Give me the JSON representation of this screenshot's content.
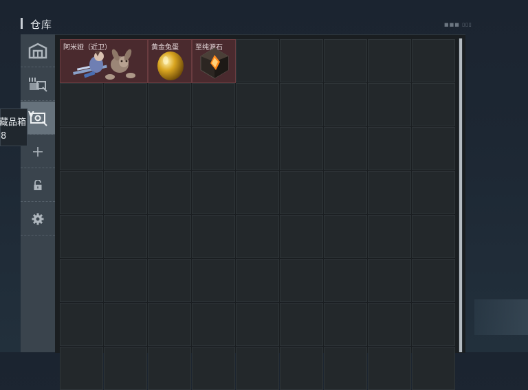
{
  "header": {
    "title": "仓库",
    "deco_text": "■■■ ▯▯▯"
  },
  "sidebar": {
    "items": [
      {
        "name": "warehouse-icon",
        "active": false
      },
      {
        "name": "operator-icon",
        "active": false
      },
      {
        "name": "vault-icon",
        "active": true
      },
      {
        "name": "plus-icon",
        "active": false
      },
      {
        "name": "lock-icon",
        "active": false
      },
      {
        "name": "gear-icon",
        "active": false
      }
    ]
  },
  "tooltip": {
    "name": "藏品箱",
    "count": "8"
  },
  "grid": {
    "columns": 9,
    "rows": 8,
    "items": [
      {
        "label": "阿米娅（近卫）",
        "icon": "amiya-guard-figure",
        "col": 0,
        "span": 2
      },
      {
        "label": "黄金兔蛋",
        "icon": "golden-egg",
        "col": 2,
        "span": 1
      },
      {
        "label": "至纯源石",
        "icon": "originium-crystal",
        "col": 3,
        "span": 1
      }
    ]
  },
  "colors": {
    "item_bg": "#4a2a2e",
    "active_tab": "#66727c",
    "cell_bg": "#23282b"
  }
}
